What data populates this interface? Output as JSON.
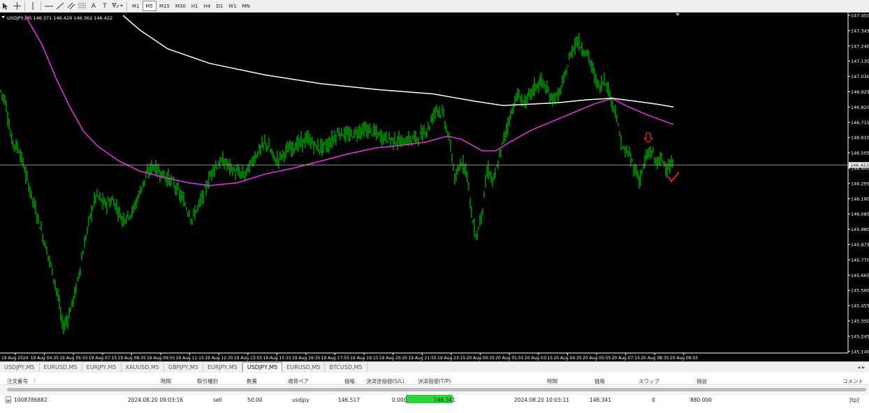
{
  "toolbar": {
    "timeframes": [
      "M1",
      "M5",
      "M15",
      "M30",
      "H1",
      "H4",
      "D1",
      "W1",
      "MN"
    ],
    "active_timeframe": "M5",
    "text_label": "A",
    "text_tool": "T"
  },
  "chart": {
    "header": "USDJPY,M5  146.371 146.429 146.362 146.422",
    "current_price": "146.422",
    "price_labels": [
      "147.450",
      "147.345",
      "147.240",
      "147.135",
      "147.030",
      "146.925",
      "146.820",
      "146.715",
      "146.610",
      "146.505",
      "146.400",
      "146.295",
      "146.190",
      "146.085",
      "145.980",
      "145.875",
      "145.770",
      "145.665",
      "145.560",
      "145.455",
      "145.350",
      "145.245",
      "145.140"
    ],
    "time_labels": [
      "19 Aug 2024",
      "19 Aug 04:35",
      "19 Aug 05:55",
      "19 Aug 07:15",
      "19 Aug 08:35",
      "19 Aug 09:55",
      "19 Aug 11:15",
      "19 Aug 12:35",
      "19 Aug 13:55",
      "19 Aug 15:15",
      "19 Aug 16:35",
      "19 Aug 17:55",
      "19 Aug 19:15",
      "19 Aug 20:35",
      "19 Aug 21:55",
      "19 Aug 23:15",
      "20 Aug 00:35",
      "20 Aug 01:55",
      "20 Aug 03:15",
      "20 Aug 04:35",
      "20 Aug 05:55",
      "20 Aug 07:15",
      "20 Aug 08:35",
      "20 Aug 09:55"
    ],
    "colors": {
      "background": "#000000",
      "candle": "#00e600",
      "ma_fast": "#e633e6",
      "ma_slow": "#ffffff",
      "arrow": "#ff2020"
    }
  },
  "tabs": [
    "USDJPY,M5",
    "EURUSD,M5",
    "EURJPY,M5",
    "XAUUSD,M5",
    "GBPJPY,M5",
    "EURJPY,M5",
    "USDJPY,M5",
    "EURUSD,M5",
    "BTCUSD,M5"
  ],
  "active_tab_index": 6,
  "orders": {
    "headers": {
      "order_no": "注文番号",
      "time": "時間",
      "type": "取引種別",
      "volume": "数量",
      "pair": "通貨ペア",
      "price": "価格",
      "sl": "決済逆指値(S/L)",
      "tp": "決済指値(T/P)",
      "close_time": "時間",
      "close_price": "価格",
      "swap": "スワップ",
      "profit": "損益",
      "comment": "コメント"
    },
    "row": {
      "order_no": "1008786882",
      "time": "2024.08.20 09:03:16",
      "type": "sell",
      "volume": "50.00",
      "pair": "usdjpy",
      "price": "146.517",
      "sl": "0.000",
      "tp": "146.341",
      "close_time": "2024.08.20 10:03:11",
      "close_price": "146.341",
      "swap": "0",
      "profit": "880 000",
      "comment": "[tp]"
    }
  }
}
